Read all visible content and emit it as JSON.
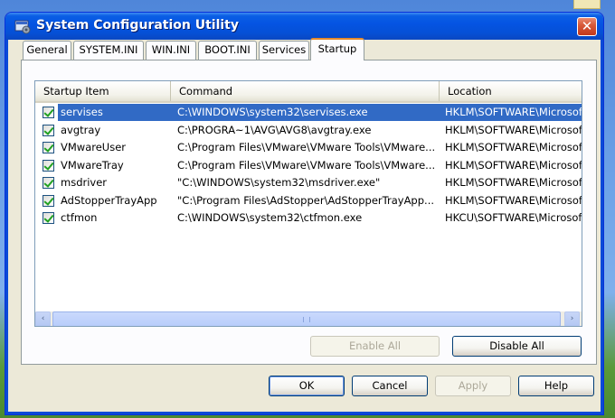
{
  "window": {
    "title": "System Configuration Utility",
    "close_glyph": "✕"
  },
  "tabs": [
    {
      "label": "General"
    },
    {
      "label": "SYSTEM.INI"
    },
    {
      "label": "WIN.INI"
    },
    {
      "label": "BOOT.INI"
    },
    {
      "label": "Services"
    },
    {
      "label": "Startup",
      "active": true
    }
  ],
  "startup_list": {
    "columns": [
      "Startup Item",
      "Command",
      "Location"
    ],
    "rows": [
      {
        "checked": true,
        "item": "servises",
        "command": "C:\\WINDOWS\\system32\\servises.exe",
        "location": "HKLM\\SOFTWARE\\Microsoft",
        "selected": true
      },
      {
        "checked": true,
        "item": "avgtray",
        "command": "C:\\PROGRA~1\\AVG\\AVG8\\avgtray.exe",
        "location": "HKLM\\SOFTWARE\\Microsoft"
      },
      {
        "checked": true,
        "item": "VMwareUser",
        "command": "C:\\Program Files\\VMware\\VMware Tools\\VMware...",
        "location": "HKLM\\SOFTWARE\\Microsoft"
      },
      {
        "checked": true,
        "item": "VMwareTray",
        "command": "C:\\Program Files\\VMware\\VMware Tools\\VMware...",
        "location": "HKLM\\SOFTWARE\\Microsoft"
      },
      {
        "checked": true,
        "item": "msdriver",
        "command": "\"C:\\WINDOWS\\system32\\msdriver.exe\"",
        "location": "HKLM\\SOFTWARE\\Microsoft"
      },
      {
        "checked": true,
        "item": "AdStopperTrayApp",
        "command": "\"C:\\Program Files\\AdStopper\\AdStopperTrayApp...",
        "location": "HKLM\\SOFTWARE\\Microsoft"
      },
      {
        "checked": true,
        "item": "ctfmon",
        "command": "C:\\WINDOWS\\system32\\ctfmon.exe",
        "location": "HKCU\\SOFTWARE\\Microsoft"
      }
    ]
  },
  "panel_buttons": {
    "enable_all": "Enable All",
    "disable_all": "Disable All"
  },
  "dialog_buttons": {
    "ok": "OK",
    "cancel": "Cancel",
    "apply": "Apply",
    "help": "Help"
  },
  "scrollbar": {
    "left_glyph": "‹",
    "right_glyph": "›"
  },
  "colors": {
    "titlebar": "#0554e3",
    "selection": "#316ac5",
    "active_tab_accent": "#e68b2c"
  },
  "icons": {
    "title": "system-config-icon",
    "close": "close-icon",
    "checkbox": "checkmark-icon"
  }
}
